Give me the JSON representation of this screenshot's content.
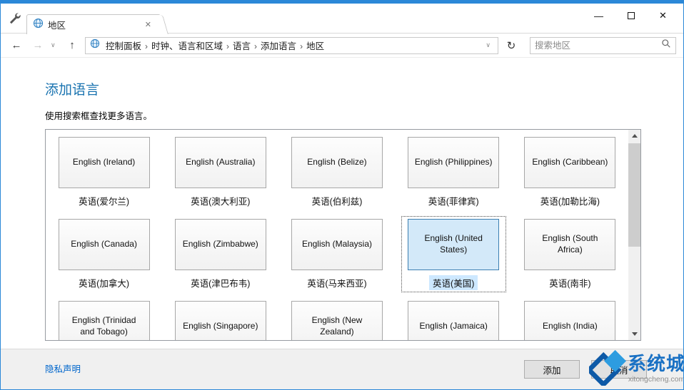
{
  "icons": {
    "minimize": "—",
    "close": "✕",
    "back": "←",
    "forward": "→",
    "up": "↑",
    "refresh": "↻",
    "chevron_down": "∨",
    "breadcrumb_sep": "›"
  },
  "colors": {
    "accent_blue": "#2b88d8",
    "title_blue": "#1973b0",
    "link_blue": "#0066cc",
    "selected_bg": "#d3e9f9",
    "selected_border": "#3c7fb1"
  },
  "window": {
    "tab_title": "地区"
  },
  "navbar": {
    "breadcrumb": [
      "控制面板",
      "时钟、语言和区域",
      "语言",
      "添加语言",
      "地区"
    ],
    "search": {
      "placeholder": "搜索地区",
      "value": ""
    }
  },
  "page": {
    "title": "添加语言",
    "subtitle": "使用搜索框查找更多语言。"
  },
  "languages": [
    {
      "name": "English (Ireland)",
      "native": "英语(爱尔兰)",
      "selected": false
    },
    {
      "name": "English (Australia)",
      "native": "英语(澳大利亚)",
      "selected": false
    },
    {
      "name": "English (Belize)",
      "native": "英语(伯利兹)",
      "selected": false
    },
    {
      "name": "English (Philippines)",
      "native": "英语(菲律宾)",
      "selected": false
    },
    {
      "name": "English (Caribbean)",
      "native": "英语(加勒比海)",
      "selected": false
    },
    {
      "name": "English (Canada)",
      "native": "英语(加拿大)",
      "selected": false
    },
    {
      "name": "English (Zimbabwe)",
      "native": "英语(津巴布韦)",
      "selected": false
    },
    {
      "name": "English (Malaysia)",
      "native": "英语(马来西亚)",
      "selected": false
    },
    {
      "name": "English (United States)",
      "native": "英语(美国)",
      "selected": true
    },
    {
      "name": "English (South Africa)",
      "native": "英语(南非)",
      "selected": false
    },
    {
      "name": "English (Trinidad and Tobago)",
      "native": "",
      "selected": false
    },
    {
      "name": "English (Singapore)",
      "native": "",
      "selected": false
    },
    {
      "name": "English (New Zealand)",
      "native": "",
      "selected": false
    },
    {
      "name": "English (Jamaica)",
      "native": "",
      "selected": false
    },
    {
      "name": "English (India)",
      "native": "",
      "selected": false
    }
  ],
  "footer": {
    "privacy": "隐私声明",
    "add": "添加",
    "cancel": "取消"
  },
  "watermark": {
    "brand": "系统城",
    "domain": "xitongcheng.com"
  }
}
